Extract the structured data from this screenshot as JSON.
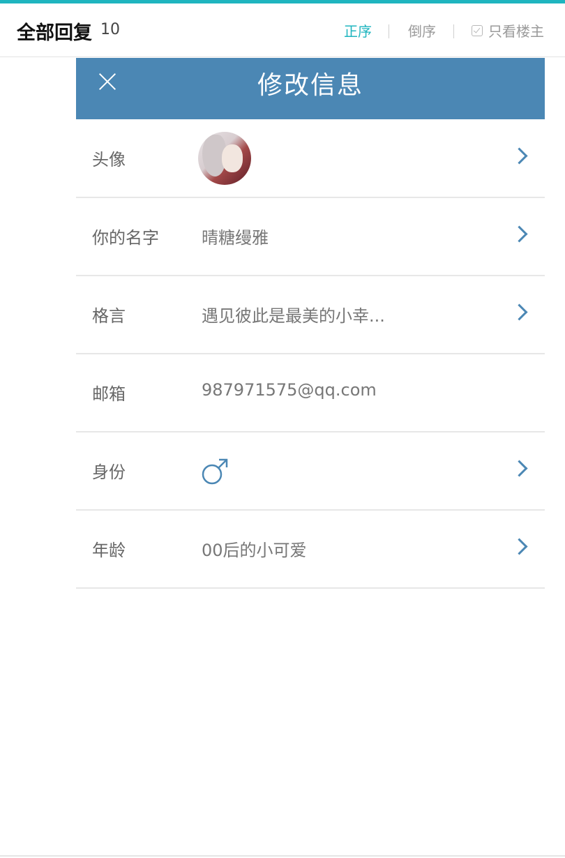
{
  "topbar": {
    "title": "全部回复",
    "count": "10",
    "sort_asc": "正序",
    "sort_desc": "倒序",
    "only_op": "只看楼主",
    "accent_color": "#1fb5bf"
  },
  "dialog": {
    "title": "修改信息",
    "header_color": "#4b87b4",
    "rows": [
      {
        "label": "头像",
        "type": "avatar",
        "value": ""
      },
      {
        "label": "你的名字",
        "value": "晴糖缦雅"
      },
      {
        "label": "格言",
        "value": "遇见彼此是最美的小幸..."
      },
      {
        "label": "邮箱",
        "value": "987971575@qq.com"
      },
      {
        "label": "身份",
        "type": "gender",
        "value": "♂",
        "icon": "male-icon"
      },
      {
        "label": "年龄",
        "value": "00后的小可爱"
      }
    ]
  }
}
